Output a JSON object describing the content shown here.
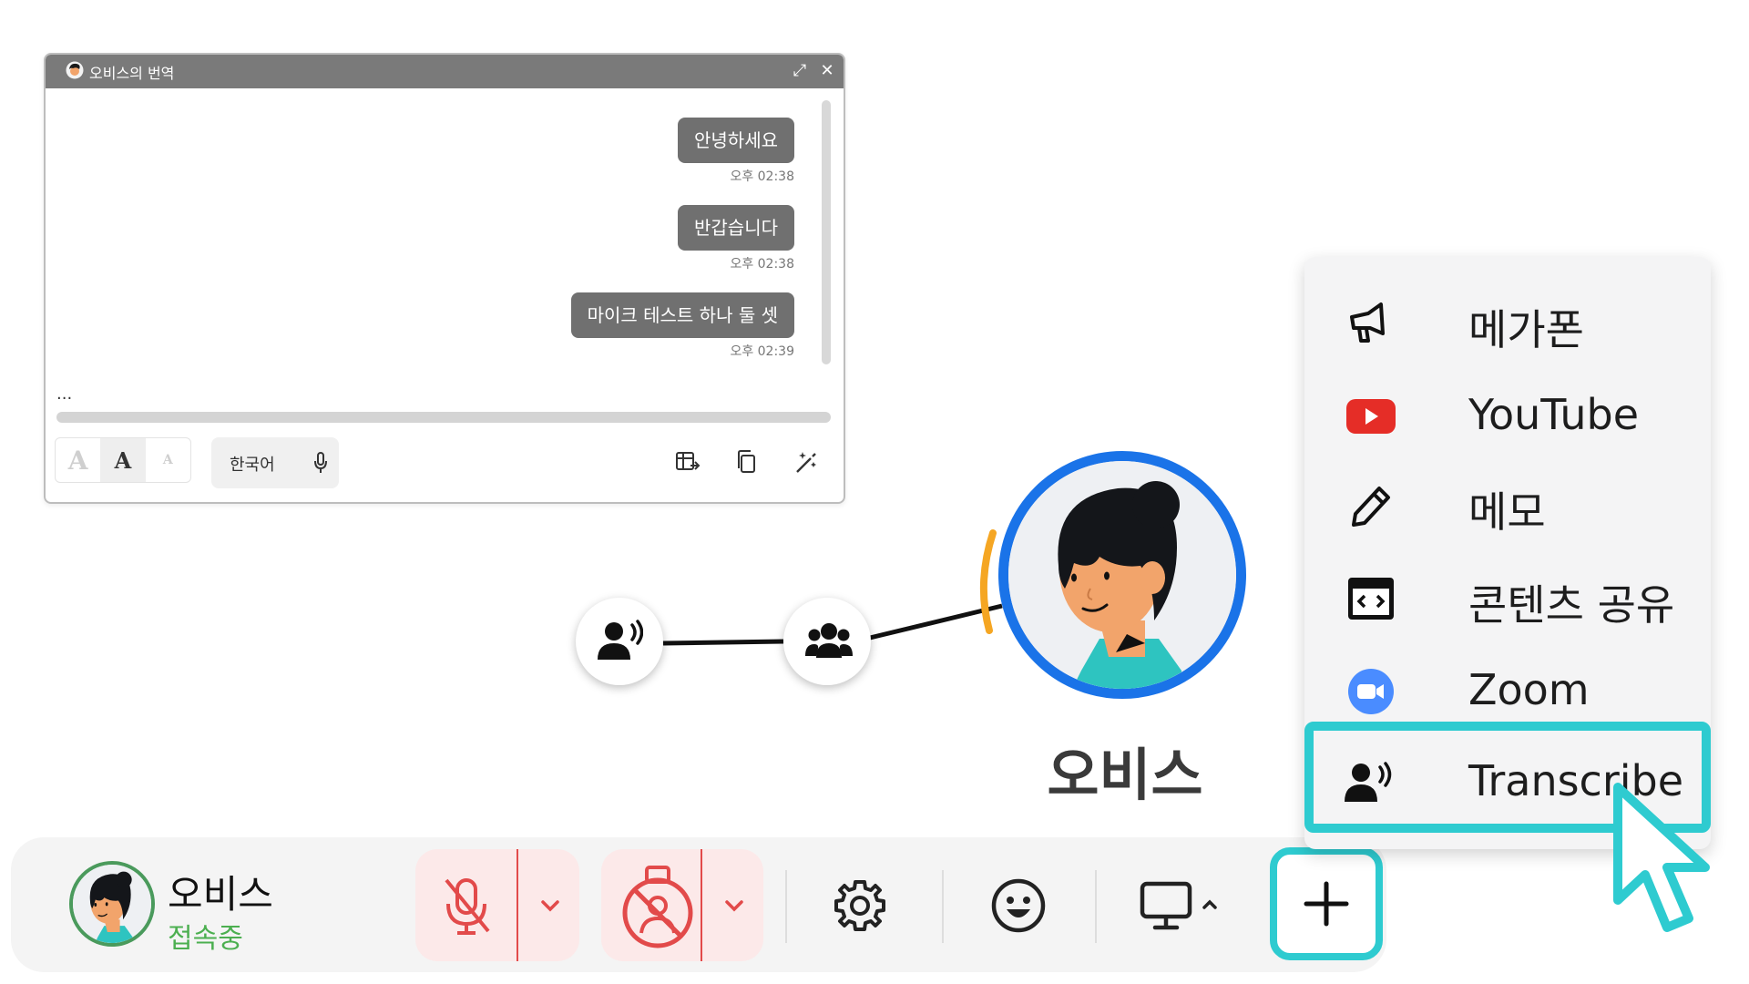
{
  "translate_window": {
    "title": "오비스의 번역",
    "messages": [
      {
        "text": "안녕하세요",
        "time": "오후 02:38"
      },
      {
        "text": "반갑습니다",
        "time": "오후 02:38"
      },
      {
        "text": "마이크 테스트 하나 둘 셋",
        "time": "오후 02:39"
      }
    ],
    "ellipsis": "...",
    "font_buttons": [
      "A",
      "A",
      "A"
    ],
    "language": "한국어"
  },
  "graph": {
    "speaker_name": "오비스"
  },
  "bottom_bar": {
    "user_name": "오비스",
    "user_status": "접속중"
  },
  "menu": {
    "items": [
      {
        "label": "메가폰",
        "icon": "megaphone-icon"
      },
      {
        "label": "YouTube",
        "icon": "youtube-icon"
      },
      {
        "label": "메모",
        "icon": "pencil-icon"
      },
      {
        "label": "콘텐츠 공유",
        "icon": "code-window-icon"
      },
      {
        "label": "Zoom",
        "icon": "zoom-icon"
      },
      {
        "label": "Transcribe",
        "icon": "transcribe-icon"
      }
    ]
  },
  "colors": {
    "accent_cyan": "#2ecbd0",
    "avatar_ring": "#1a73e8",
    "status_green": "#4caf50",
    "mute_red": "#e24a4a",
    "youtube_red": "#e52d27",
    "zoom_blue": "#4a8cff"
  }
}
